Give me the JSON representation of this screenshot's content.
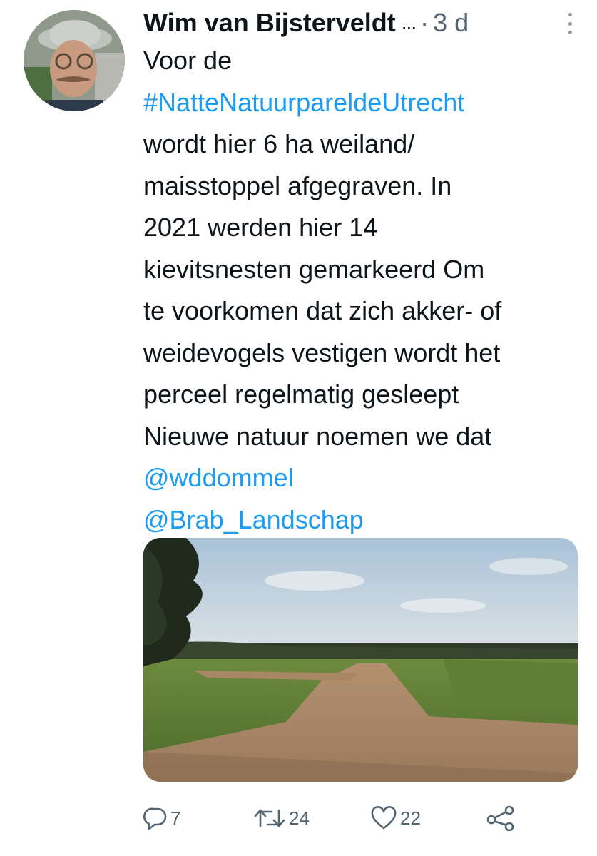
{
  "tweet": {
    "author_name": "Wim van Bijsterveldt",
    "ellipsis": "...",
    "separator": "·",
    "time": "3 d",
    "text_lines": [
      {
        "text": "Voor de",
        "link": false
      },
      {
        "text": "#NatteNatuurpareldeUtrecht",
        "link": true
      },
      {
        "text": "wordt hier 6 ha weiland/",
        "link": false
      },
      {
        "text": "maisstoppel afgegraven. In",
        "link": false
      },
      {
        "text": "2021 werden hier 14",
        "link": false
      },
      {
        "text": "kievitsnesten gemarkeerd Om",
        "link": false
      },
      {
        "text": "te voorkomen dat zich akker- of",
        "link": false
      },
      {
        "text": "weidevogels vestigen wordt het",
        "link": false
      },
      {
        "text": "perceel regelmatig gesleept",
        "link": false
      },
      {
        "text": "Nieuwe natuur noemen we dat",
        "link": false
      },
      {
        "text": "@wddommel",
        "link": true
      },
      {
        "text": "@Brab_Landschap",
        "link": true
      }
    ]
  },
  "actions": {
    "reply_count": "7",
    "retweet_count": "24",
    "like_count": "22"
  },
  "icons": {
    "avatar": "avatar-photo",
    "more": "more-options-icon",
    "reply": "reply-icon",
    "retweet": "retweet-icon",
    "like": "heart-icon",
    "share": "share-icon"
  },
  "colors": {
    "link": "#1d9bf0",
    "text": "#0f1419",
    "secondary": "#536471"
  }
}
